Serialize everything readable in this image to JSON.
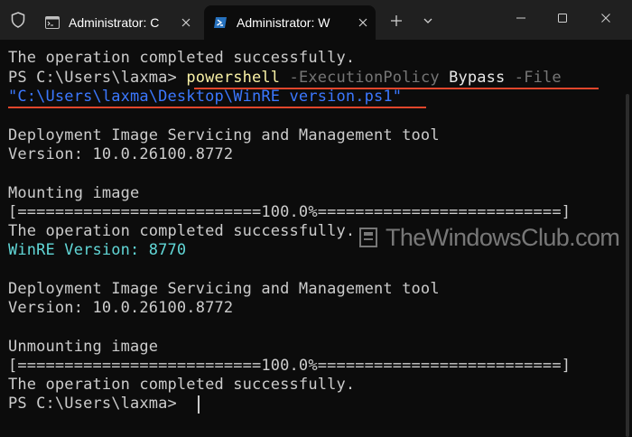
{
  "colors": {
    "background": "#0c0c0c",
    "titlebar": "#202020",
    "text": "#cccccc",
    "command_yellow": "#f9f1a5",
    "parameter_gray": "#767676",
    "string_blue": "#3b78ff",
    "winre_cyan": "#61d6d6",
    "annotation_red": "#e0462c"
  },
  "tabs": [
    {
      "title": "Administrator: C",
      "icon": "cmd-icon",
      "active": false
    },
    {
      "title": "Administrator: W",
      "icon": "powershell-icon",
      "active": true
    }
  ],
  "toolbar": {
    "new_tab": "+",
    "dropdown": "⌄"
  },
  "window_controls": {
    "minimize": "minimize-icon",
    "maximize": "maximize-icon",
    "close": "close-icon"
  },
  "terminal": {
    "lines": {
      "l1": "The operation completed successfully.",
      "l2_prompt": "PS C:\\Users\\laxma> ",
      "l2_cmd": "powershell",
      "l2_param1": " -ExecutionPolicy",
      "l2_arg1": " Bypass",
      "l2_param2": " -File",
      "l3": "\"C:\\Users\\laxma\\Desktop\\WinRE version.ps1\"",
      "l5": "Deployment Image Servicing and Management tool",
      "l6": "Version: 10.0.26100.8772",
      "l8": "Mounting image",
      "l9": "[==========================100.0%==========================]",
      "l10": "The operation completed successfully.",
      "l11": "WinRE Version: 8770",
      "l13": "Deployment Image Servicing and Management tool",
      "l14": "Version: 10.0.26100.8772",
      "l16": "Unmounting image",
      "l17": "[==========================100.0%==========================]",
      "l18": "The operation completed successfully.",
      "l19_prompt": "PS C:\\Users\\laxma> "
    }
  },
  "watermark": {
    "text": "TheWindowsClub.com"
  }
}
